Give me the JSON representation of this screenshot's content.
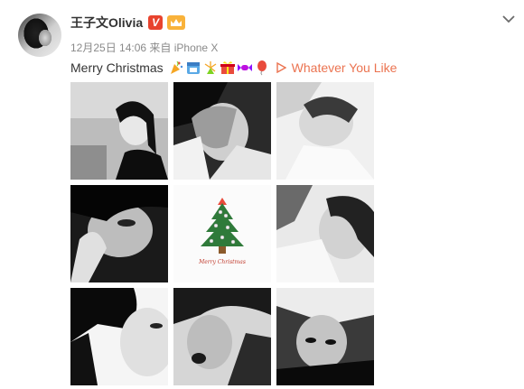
{
  "post": {
    "username": "王子文Olivia",
    "verified_badge": "V",
    "badges": [
      "crown-icon"
    ],
    "meta": "12月25日 14:06 来自 iPhone X",
    "text": "Merry Christmas",
    "emojis": [
      "party-emoji",
      "calendar-emoji",
      "fireworks-emoji",
      "gift-emoji",
      "candy-emoji",
      "balloon-emoji"
    ],
    "link_text": "Whatever You Like",
    "link_icon": "play-icon"
  },
  "photos": [
    {
      "alt": "photo-1"
    },
    {
      "alt": "photo-2"
    },
    {
      "alt": "photo-3"
    },
    {
      "alt": "photo-4"
    },
    {
      "alt": "photo-5",
      "caption": "Merry Christmas"
    },
    {
      "alt": "photo-6"
    },
    {
      "alt": "photo-7"
    },
    {
      "alt": "photo-8"
    },
    {
      "alt": "photo-9"
    }
  ],
  "colors": {
    "link": "#eb7350",
    "username": "#333333",
    "meta": "#8a8a8a",
    "verified": "#e8432e",
    "tree": "#2f7a3a"
  }
}
